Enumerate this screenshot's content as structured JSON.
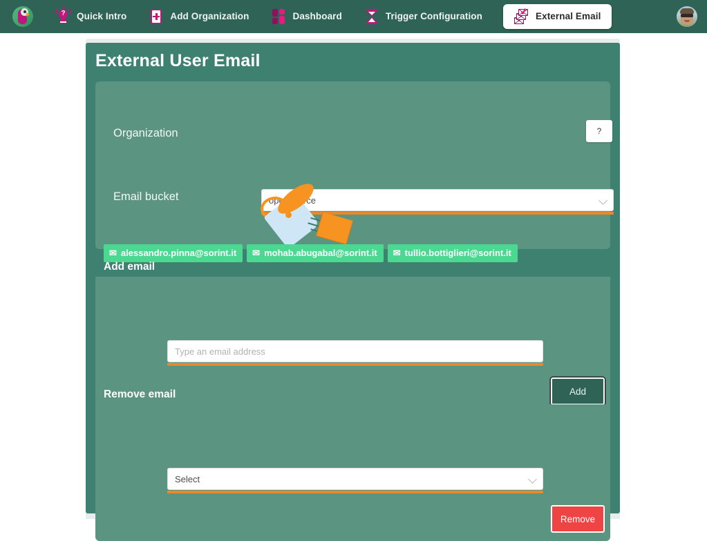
{
  "navbar": {
    "logo_name": "sorint-parrot-logo",
    "items": [
      {
        "label": "Quick Intro",
        "icon": "lightbulb-question-icon",
        "active": false
      },
      {
        "label": "Add Organization",
        "icon": "plus-box-icon",
        "active": false
      },
      {
        "label": "Dashboard",
        "icon": "dashboard-blocks-icon",
        "active": false
      },
      {
        "label": "Trigger Configuration",
        "icon": "hourglass-icon",
        "active": false
      },
      {
        "label": "External Email",
        "icon": "stacked-envelopes-icon",
        "active": true
      }
    ],
    "avatar_name": "user-avatar"
  },
  "page": {
    "title": "External User Email"
  },
  "organization": {
    "label": "Organization",
    "select_value": "opensource",
    "help_label": "?",
    "bucket_label": "Email bucket",
    "bucket_art_name": "email-bucket-illustration",
    "chips": [
      {
        "email": "alessandro.pinna@sorint.it",
        "icon": "envelope-icon"
      },
      {
        "email": "mohab.abugabal@sorint.it",
        "icon": "envelope-icon"
      },
      {
        "email": "tullio.bottiglieri@sorint.it",
        "icon": "envelope-icon"
      }
    ]
  },
  "add_email": {
    "heading": "Add email",
    "input_value": "",
    "input_placeholder": "Type an email address",
    "button_label": "Add"
  },
  "remove_email": {
    "heading": "Remove email",
    "select_value": "Select",
    "button_label": "Remove"
  },
  "colors": {
    "nav_bg": "#2f6355",
    "card_bg": "#3e8171",
    "panel_bg": "#5b9481",
    "accent_orange": "#e8892b",
    "chip_green": "#4bd992",
    "danger_red": "#ef4444",
    "brand_magenta": "#c2157e"
  },
  "glyphs": {
    "envelope": "✉",
    "question": "?"
  }
}
